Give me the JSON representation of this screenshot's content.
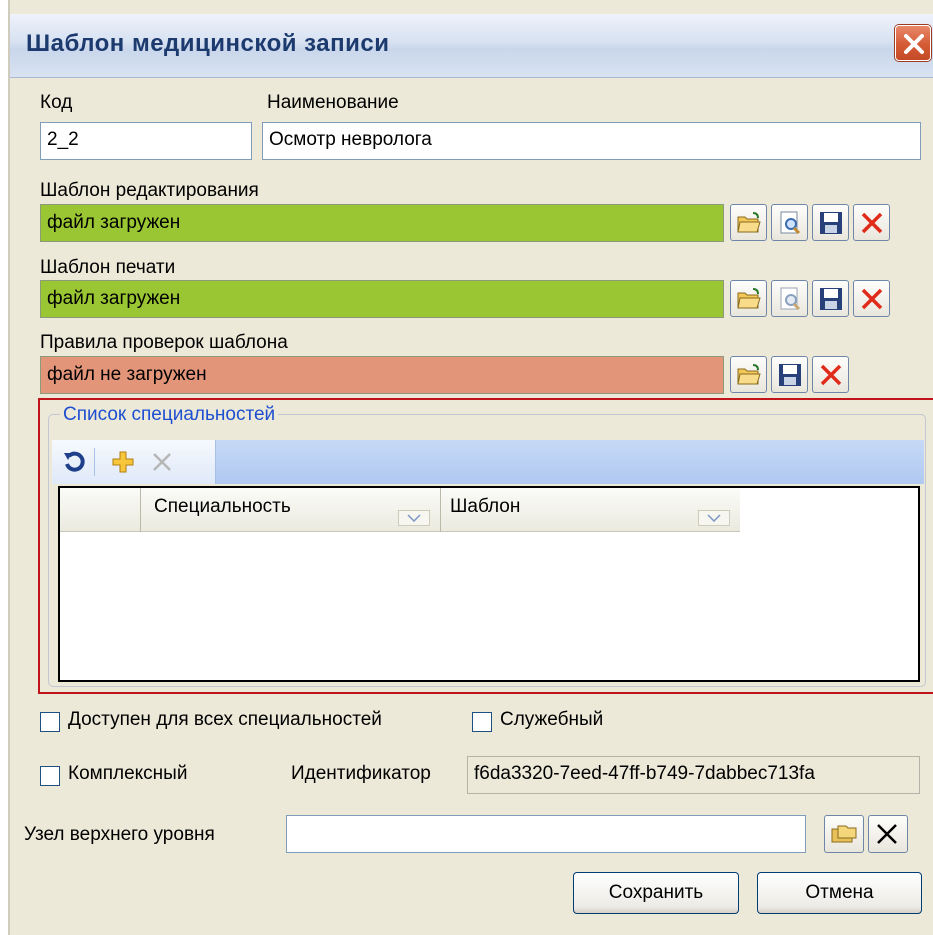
{
  "window": {
    "title": "Шаблон медицинской записи"
  },
  "fields": {
    "code_label": "Код",
    "code_value": "2_2",
    "name_label": "Наименование",
    "name_value": "Осмотр невролога"
  },
  "edit_template": {
    "label": "Шаблон редактирования",
    "status": "файл загружен"
  },
  "print_template": {
    "label": "Шаблон печати",
    "status": "файл загружен"
  },
  "check_rules": {
    "label": "Правила проверок шаблона",
    "status": "файл не загружен"
  },
  "specialties": {
    "title": "Список специальностей",
    "columns": [
      "Специальность",
      "Шаблон"
    ],
    "rows": []
  },
  "options": {
    "all_specialties_label": "Доступен для всех специальностей",
    "service_label": "Служебный",
    "complex_label": "Комплексный",
    "identifier_label": "Идентификатор",
    "identifier_value": "f6da3320-7eed-47ff-b749-7dabbec713fa",
    "parent_node_label": "Узел верхнего уровня",
    "parent_node_value": ""
  },
  "buttons": {
    "save": "Сохранить",
    "cancel": "Отмена"
  },
  "colors": {
    "loaded": "#99c632",
    "not_loaded": "#e3957a",
    "group_border": "#c0141a",
    "group_title": "#1e4fd1"
  },
  "icons": [
    "close-icon",
    "open-folder-icon",
    "preview-icon",
    "save-disk-icon",
    "delete-x-icon",
    "refresh-icon",
    "add-plus-icon",
    "folder-browse-icon",
    "clear-x-icon",
    "sort-down-icon"
  ]
}
